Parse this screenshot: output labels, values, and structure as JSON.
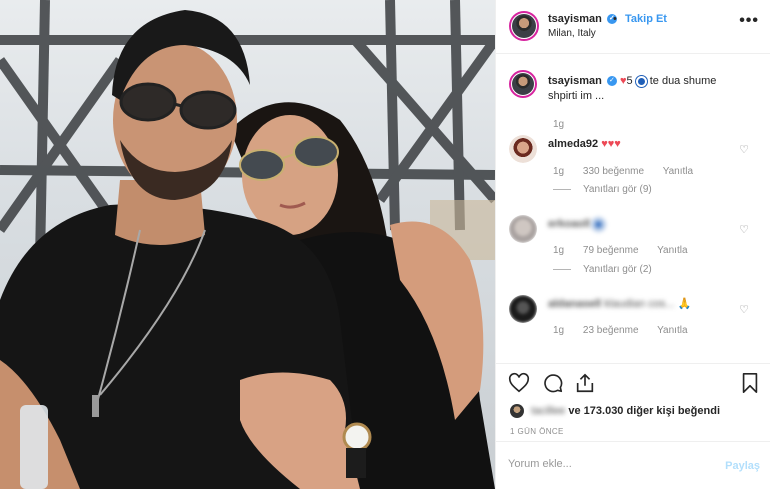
{
  "post": {
    "username": "tsayisman",
    "follow_label": "Takip Et",
    "separator": "•",
    "location": "Milan, Italy",
    "more_label": "•••"
  },
  "caption": {
    "username": "tsayisman",
    "count_text": "5",
    "text": "te dua shume shpirti im ...",
    "time": "1g"
  },
  "comments": [
    {
      "username": "almeda92",
      "text": "♥♥♥",
      "time": "1g",
      "likes": "330 beğenme",
      "reply_label": "Yanıtla",
      "replies": "Yanıtları gör (9)"
    },
    {
      "username": "erkoaoll",
      "text": "",
      "time": "1g",
      "likes": "79 beğenme",
      "reply_label": "Yanıtla",
      "replies": "Yanıtları gör (2)"
    },
    {
      "username": "aldanasell",
      "text": "klaudian cos...",
      "time": "1g",
      "likes": "23 beğenme",
      "reply_label": "Yanıtla"
    }
  ],
  "likes_summary": {
    "user": "tacillee",
    "text": "ve 173.030 diğer kişi beğendi"
  },
  "date_label": "1 GÜN ÖNCE",
  "comment_box": {
    "placeholder": "Yorum ekle...",
    "post_label": "Paylaş"
  },
  "colors": {
    "accent": "#3897f0",
    "heart": "#ed4956",
    "muted": "#8e8e8e"
  }
}
